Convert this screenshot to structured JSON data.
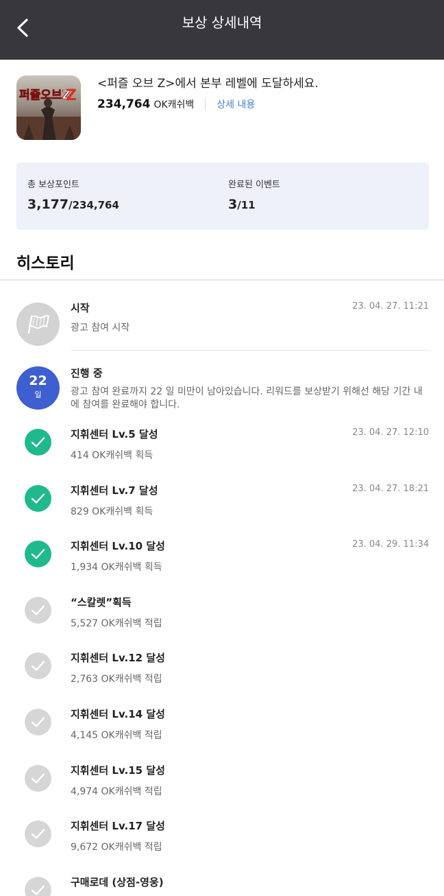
{
  "header": {
    "title": "보상 상세내역",
    "back_icon": "chevron-left-icon"
  },
  "app": {
    "icon": "puzzle-of-z-app-icon",
    "icon_text": "퍼즐오브Z",
    "description": "<퍼즐 오브 Z>에서 본부 레벨에 도달하세요.",
    "reward_amount": "234,764",
    "reward_unit": "OK캐쉬백",
    "detail_link": "상세 내용"
  },
  "summary": {
    "total_label": "총 보상포인트",
    "total_earned": "3,177",
    "total_max": "/234,764",
    "completed_label": "완료된 이벤트",
    "completed_count": "3",
    "completed_total": "/11"
  },
  "history": {
    "title": "히스토리",
    "start": {
      "title": "시작",
      "subtitle": "광고 참여 시작",
      "time": "23. 04. 27. 11:21",
      "icon": "flag-icon"
    },
    "progress": {
      "days": "22",
      "day_unit": "일",
      "title": "진행 중",
      "message": "광고 참여 완료까지 22 일 미만이 남아있습니다. 리워드를 보상받기 위해선 해당 기간 내에 참여를 완료해야 합니다."
    },
    "events": [
      {
        "title": "지휘센터 Lv.5 달성",
        "subtitle": "414 OK캐쉬백 획득",
        "time": "23. 04. 27. 12:10",
        "status": "done"
      },
      {
        "title": "지휘센터 Lv.7 달성",
        "subtitle": "829 OK캐쉬백 획득",
        "time": "23. 04. 27. 18:21",
        "status": "done"
      },
      {
        "title": "지휘센터 Lv.10 달성",
        "subtitle": "1,934 OK캐쉬백 획득",
        "time": "23. 04. 29. 11:34",
        "status": "done"
      },
      {
        "title": "“스칼렛”획득",
        "subtitle": "5,527 OK캐쉬백 적립",
        "time": "",
        "status": "pending"
      },
      {
        "title": "지휘센터 Lv.12 달성",
        "subtitle": "2,763 OK캐쉬백 적립",
        "time": "",
        "status": "pending"
      },
      {
        "title": "지휘센터 Lv.14 달성",
        "subtitle": "4,145 OK캐쉬백 적립",
        "time": "",
        "status": "pending"
      },
      {
        "title": "지휘센터 Lv.15 달성",
        "subtitle": "4,974 OK캐쉬백 적립",
        "time": "",
        "status": "pending"
      },
      {
        "title": "지휘센터 Lv.17 달성",
        "subtitle": "9,672 OK캐쉬백 적립",
        "time": "",
        "status": "pending"
      },
      {
        "title": "구매로데 (상점-영웅)",
        "subtitle": "",
        "time": "",
        "status": "pending"
      }
    ]
  },
  "colors": {
    "header_bg": "#38373c",
    "link": "#3f7fd9",
    "summary_bg": "#eef1fa",
    "progress_circle": "#3e5fd0",
    "done_check": "#1fb98d",
    "pending_check": "#d6d6d6"
  }
}
